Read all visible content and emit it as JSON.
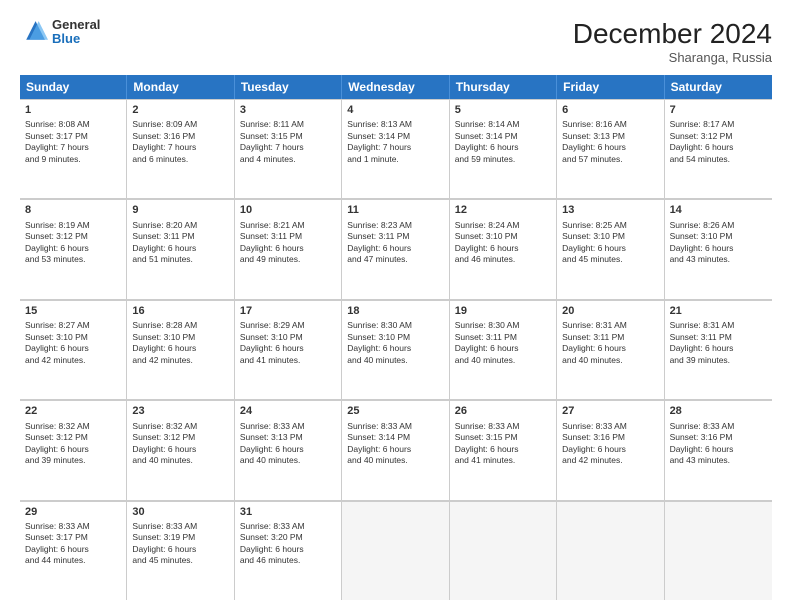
{
  "header": {
    "logo_general": "General",
    "logo_blue": "Blue",
    "month_title": "December 2024",
    "location": "Sharanga, Russia"
  },
  "days_of_week": [
    "Sunday",
    "Monday",
    "Tuesday",
    "Wednesday",
    "Thursday",
    "Friday",
    "Saturday"
  ],
  "weeks": [
    [
      {
        "day": "1",
        "lines": [
          "Sunrise: 8:08 AM",
          "Sunset: 3:17 PM",
          "Daylight: 7 hours",
          "and 9 minutes."
        ]
      },
      {
        "day": "2",
        "lines": [
          "Sunrise: 8:09 AM",
          "Sunset: 3:16 PM",
          "Daylight: 7 hours",
          "and 6 minutes."
        ]
      },
      {
        "day": "3",
        "lines": [
          "Sunrise: 8:11 AM",
          "Sunset: 3:15 PM",
          "Daylight: 7 hours",
          "and 4 minutes."
        ]
      },
      {
        "day": "4",
        "lines": [
          "Sunrise: 8:13 AM",
          "Sunset: 3:14 PM",
          "Daylight: 7 hours",
          "and 1 minute."
        ]
      },
      {
        "day": "5",
        "lines": [
          "Sunrise: 8:14 AM",
          "Sunset: 3:14 PM",
          "Daylight: 6 hours",
          "and 59 minutes."
        ]
      },
      {
        "day": "6",
        "lines": [
          "Sunrise: 8:16 AM",
          "Sunset: 3:13 PM",
          "Daylight: 6 hours",
          "and 57 minutes."
        ]
      },
      {
        "day": "7",
        "lines": [
          "Sunrise: 8:17 AM",
          "Sunset: 3:12 PM",
          "Daylight: 6 hours",
          "and 54 minutes."
        ]
      }
    ],
    [
      {
        "day": "8",
        "lines": [
          "Sunrise: 8:19 AM",
          "Sunset: 3:12 PM",
          "Daylight: 6 hours",
          "and 53 minutes."
        ]
      },
      {
        "day": "9",
        "lines": [
          "Sunrise: 8:20 AM",
          "Sunset: 3:11 PM",
          "Daylight: 6 hours",
          "and 51 minutes."
        ]
      },
      {
        "day": "10",
        "lines": [
          "Sunrise: 8:21 AM",
          "Sunset: 3:11 PM",
          "Daylight: 6 hours",
          "and 49 minutes."
        ]
      },
      {
        "day": "11",
        "lines": [
          "Sunrise: 8:23 AM",
          "Sunset: 3:11 PM",
          "Daylight: 6 hours",
          "and 47 minutes."
        ]
      },
      {
        "day": "12",
        "lines": [
          "Sunrise: 8:24 AM",
          "Sunset: 3:10 PM",
          "Daylight: 6 hours",
          "and 46 minutes."
        ]
      },
      {
        "day": "13",
        "lines": [
          "Sunrise: 8:25 AM",
          "Sunset: 3:10 PM",
          "Daylight: 6 hours",
          "and 45 minutes."
        ]
      },
      {
        "day": "14",
        "lines": [
          "Sunrise: 8:26 AM",
          "Sunset: 3:10 PM",
          "Daylight: 6 hours",
          "and 43 minutes."
        ]
      }
    ],
    [
      {
        "day": "15",
        "lines": [
          "Sunrise: 8:27 AM",
          "Sunset: 3:10 PM",
          "Daylight: 6 hours",
          "and 42 minutes."
        ]
      },
      {
        "day": "16",
        "lines": [
          "Sunrise: 8:28 AM",
          "Sunset: 3:10 PM",
          "Daylight: 6 hours",
          "and 42 minutes."
        ]
      },
      {
        "day": "17",
        "lines": [
          "Sunrise: 8:29 AM",
          "Sunset: 3:10 PM",
          "Daylight: 6 hours",
          "and 41 minutes."
        ]
      },
      {
        "day": "18",
        "lines": [
          "Sunrise: 8:30 AM",
          "Sunset: 3:10 PM",
          "Daylight: 6 hours",
          "and 40 minutes."
        ]
      },
      {
        "day": "19",
        "lines": [
          "Sunrise: 8:30 AM",
          "Sunset: 3:11 PM",
          "Daylight: 6 hours",
          "and 40 minutes."
        ]
      },
      {
        "day": "20",
        "lines": [
          "Sunrise: 8:31 AM",
          "Sunset: 3:11 PM",
          "Daylight: 6 hours",
          "and 40 minutes."
        ]
      },
      {
        "day": "21",
        "lines": [
          "Sunrise: 8:31 AM",
          "Sunset: 3:11 PM",
          "Daylight: 6 hours",
          "and 39 minutes."
        ]
      }
    ],
    [
      {
        "day": "22",
        "lines": [
          "Sunrise: 8:32 AM",
          "Sunset: 3:12 PM",
          "Daylight: 6 hours",
          "and 39 minutes."
        ]
      },
      {
        "day": "23",
        "lines": [
          "Sunrise: 8:32 AM",
          "Sunset: 3:12 PM",
          "Daylight: 6 hours",
          "and 40 minutes."
        ]
      },
      {
        "day": "24",
        "lines": [
          "Sunrise: 8:33 AM",
          "Sunset: 3:13 PM",
          "Daylight: 6 hours",
          "and 40 minutes."
        ]
      },
      {
        "day": "25",
        "lines": [
          "Sunrise: 8:33 AM",
          "Sunset: 3:14 PM",
          "Daylight: 6 hours",
          "and 40 minutes."
        ]
      },
      {
        "day": "26",
        "lines": [
          "Sunrise: 8:33 AM",
          "Sunset: 3:15 PM",
          "Daylight: 6 hours",
          "and 41 minutes."
        ]
      },
      {
        "day": "27",
        "lines": [
          "Sunrise: 8:33 AM",
          "Sunset: 3:16 PM",
          "Daylight: 6 hours",
          "and 42 minutes."
        ]
      },
      {
        "day": "28",
        "lines": [
          "Sunrise: 8:33 AM",
          "Sunset: 3:16 PM",
          "Daylight: 6 hours",
          "and 43 minutes."
        ]
      }
    ],
    [
      {
        "day": "29",
        "lines": [
          "Sunrise: 8:33 AM",
          "Sunset: 3:17 PM",
          "Daylight: 6 hours",
          "and 44 minutes."
        ]
      },
      {
        "day": "30",
        "lines": [
          "Sunrise: 8:33 AM",
          "Sunset: 3:19 PM",
          "Daylight: 6 hours",
          "and 45 minutes."
        ]
      },
      {
        "day": "31",
        "lines": [
          "Sunrise: 8:33 AM",
          "Sunset: 3:20 PM",
          "Daylight: 6 hours",
          "and 46 minutes."
        ]
      },
      {
        "day": "",
        "lines": []
      },
      {
        "day": "",
        "lines": []
      },
      {
        "day": "",
        "lines": []
      },
      {
        "day": "",
        "lines": []
      }
    ]
  ]
}
